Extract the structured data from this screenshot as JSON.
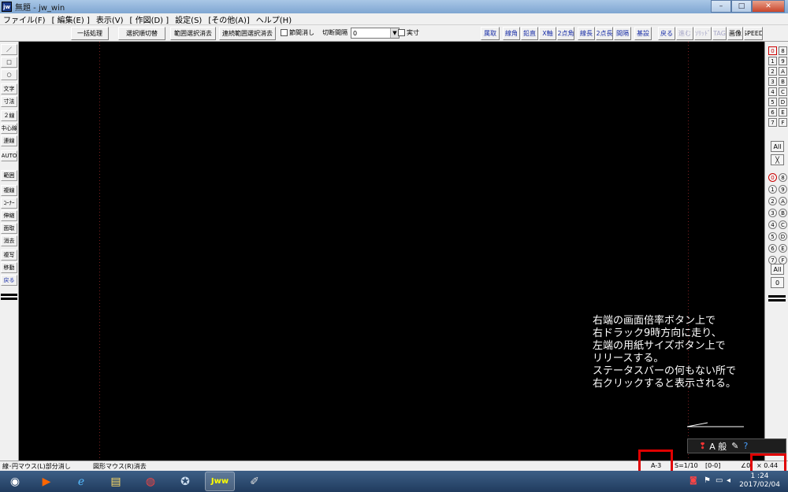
{
  "window": {
    "title": "無題 - jw_win",
    "app_icon": "jw",
    "min": "–",
    "max": "□",
    "close": "✕"
  },
  "menu": [
    "ファイル(F)",
    "[ 編集(E) ]",
    "表示(V)",
    "[ 作図(D) ]",
    "設定(S)",
    "[その他(A)]",
    "ヘルプ(H)"
  ],
  "toolbar": {
    "ikkatsu": "一括処理",
    "sentakujun": "選択順切替",
    "hanni_sentaku": "範囲選択消去",
    "renzoku_hanni": "連続範囲選択消去",
    "setsudan_check": "節間消し",
    "kiridashi_label": "切断間隔",
    "kiridashi_value": "0",
    "jissun": "実寸",
    "right_buttons": [
      "属取",
      "線角",
      "鉛直",
      "X軸",
      "2点角",
      "線長",
      "2点長",
      "間隔",
      "基設",
      "戻る",
      "進む",
      "ｿﾘｯﾄﾞ",
      "TAG",
      "画像",
      "SPEED"
    ]
  },
  "left_tools": [
    "／",
    "□",
    "○",
    "文字",
    "寸法",
    "２線",
    "中心線",
    "連線",
    "AUTO",
    "範囲",
    "複線",
    "ｺｰﾅｰ",
    "伸縮",
    "面取",
    "消去",
    "複写",
    "移動",
    "戻る"
  ],
  "right_tools": {
    "layers_top": [
      "0",
      "8",
      "1",
      "9",
      "2",
      "A",
      "3",
      "B",
      "4",
      "C",
      "5",
      "D",
      "6",
      "E",
      "7",
      "F"
    ],
    "all_top": "All",
    "cross": "╳",
    "layers_bottom": [
      "0",
      "8",
      "1",
      "9",
      "2",
      "A",
      "3",
      "B",
      "4",
      "C",
      "5",
      "D",
      "6",
      "E",
      "7",
      "F"
    ],
    "all_bottom": "All",
    "zero": "0"
  },
  "annotation": [
    "右端の画面倍率ボタン上で",
    "右ドラック9時方向に走り、",
    "左端の用紙サイズボタン上で",
    "リリースする。",
    "ステータスバーの何もない所で",
    "右クリックすると表示される。"
  ],
  "ime": {
    "mode": "A 般"
  },
  "status": {
    "left": "線･円マウス(L)部分消し",
    "center": "図形マウス(R)消去",
    "paper": "A-3",
    "scale": "S=1/10",
    "layer": "[0-0]",
    "angle": "∠0",
    "zoom": "× 0.44"
  },
  "taskbar": {
    "clock_time": "1 :24",
    "clock_date": "2017/02/04"
  },
  "colors": {
    "highlight_box": "#e00000",
    "canvas": "#000000"
  }
}
